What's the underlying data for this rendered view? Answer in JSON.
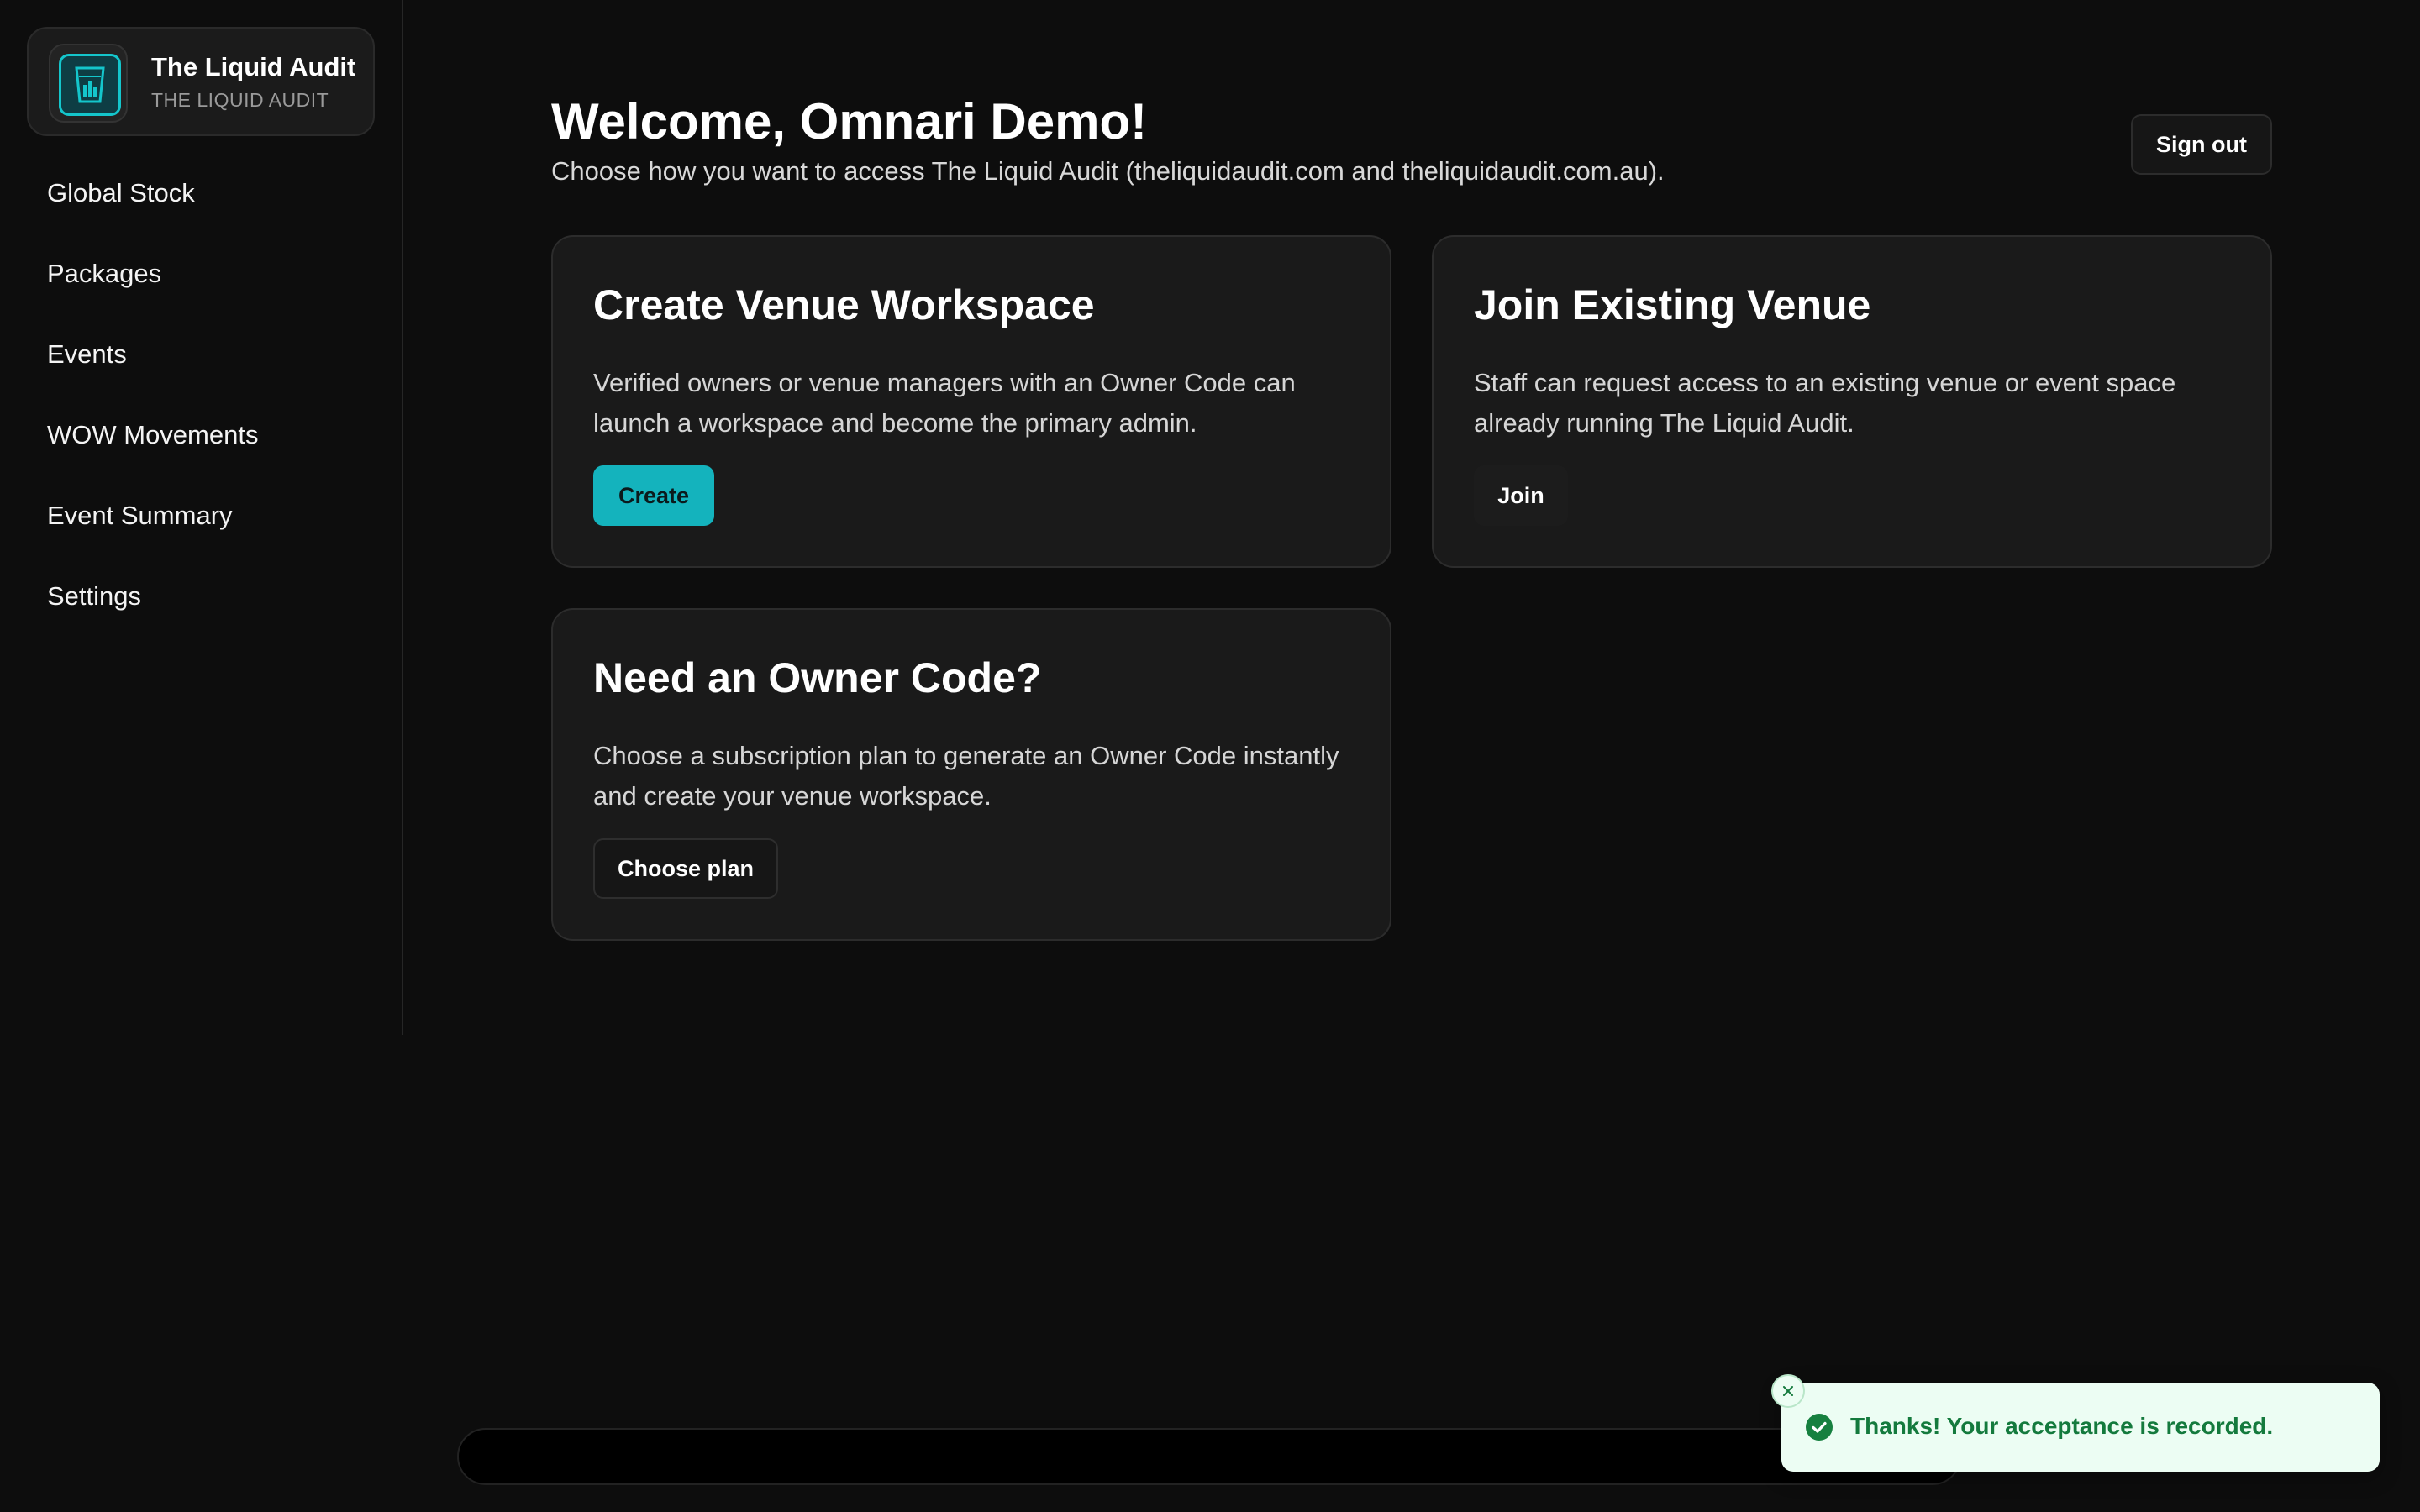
{
  "sidebar": {
    "brand_title": "The Liquid Audit",
    "brand_subtitle": "THE LIQUID AUDIT",
    "logo_icon": "glass-icon",
    "items": [
      {
        "label": "Global Stock"
      },
      {
        "label": "Packages"
      },
      {
        "label": "Events"
      },
      {
        "label": "WOW Movements"
      },
      {
        "label": "Event Summary"
      },
      {
        "label": "Settings"
      }
    ]
  },
  "header": {
    "title": "Welcome, Omnari Demo!",
    "subtitle": "Choose how you want to access The Liquid Audit (theliquidaudit.com and theliquidaudit.com.au).",
    "signout_label": "Sign out"
  },
  "cards": {
    "create": {
      "title": "Create Venue Workspace",
      "description": "Verified owners or venue managers with an Owner Code can launch a workspace and become the primary admin.",
      "button": "Create"
    },
    "join": {
      "title": "Join Existing Venue",
      "description": "Staff can request access to an existing venue or event space already running The Liquid Audit.",
      "button": "Join"
    },
    "owner_code": {
      "title": "Need an Owner Code?",
      "description": "Choose a subscription plan to generate an Owner Code instantly and create your venue workspace.",
      "button": "Choose plan"
    }
  },
  "toast": {
    "message": "Thanks! Your acceptance is recorded.",
    "icon": "check-circle-icon",
    "close_icon": "close-icon"
  },
  "colors": {
    "accent": "#14b3bd",
    "background": "#0d0d0d",
    "card": "#1a1a1a",
    "toast_bg": "#ecfdf3",
    "toast_text": "#147a3d"
  }
}
